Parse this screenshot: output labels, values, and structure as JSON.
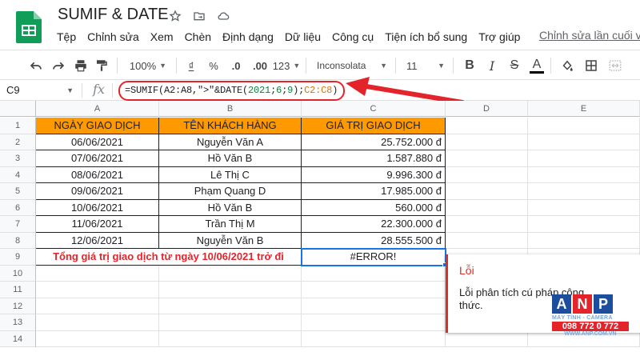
{
  "doc": {
    "title": "SUMIF & DATE"
  },
  "menu": [
    "Tệp",
    "Chỉnh sửa",
    "Xem",
    "Chèn",
    "Định dạng",
    "Dữ liệu",
    "Công cụ",
    "Tiện ích bổ sung",
    "Trợ giúp"
  ],
  "last_edit": "Chỉnh sửa lần cuối vài",
  "toolbar": {
    "zoom": "100%",
    "currency": "₫",
    "percent": "%",
    "dec_less": ".0",
    "dec_more": ".00",
    "format_more": "123",
    "font": "Inconsolata",
    "font_size": "11",
    "bold": "B",
    "italic": "I",
    "strike": "S",
    "text_color": "A"
  },
  "formula_bar": {
    "cell_ref": "C9",
    "fx": "fx",
    "formula_parts": {
      "p1": "=SUMIF(",
      "p2": "A2:A8",
      "p3": ",\">\"&DATE(",
      "p4": "2021",
      "p5": ";",
      "p6": "6",
      "p7": ";",
      "p8": "9",
      "p9": ");",
      "p10": "C2:C8",
      "p11": ")"
    }
  },
  "columns": [
    "A",
    "B",
    "C",
    "D",
    "E"
  ],
  "rows": [
    "1",
    "2",
    "3",
    "4",
    "5",
    "6",
    "7",
    "8",
    "9",
    "10",
    "11",
    "12",
    "13",
    "14"
  ],
  "table": {
    "headers": [
      "NGÀY GIAO DỊCH",
      "TÊN KHÁCH HÀNG",
      "GIÁ TRỊ GIAO DỊCH"
    ],
    "rows": [
      [
        "06/06/2021",
        "Nguyễn Văn A",
        "25.752.000 đ"
      ],
      [
        "07/06/2021",
        "Hồ Văn B",
        "1.587.880 đ"
      ],
      [
        "08/06/2021",
        "Lê Thị C",
        "9.996.300 đ"
      ],
      [
        "09/06/2021",
        "Phạm Quang D",
        "17.985.000 đ"
      ],
      [
        "10/06/2021",
        "Hồ Văn B",
        "560.000 đ"
      ],
      [
        "11/06/2021",
        "Trần Thị M",
        "22.300.000 đ"
      ],
      [
        "12/06/2021",
        "Nguyễn Văn B",
        "28.555.500 đ"
      ]
    ],
    "total_label": "Tổng giá trị giao dịch từ ngày 10/06/2021 trở đi",
    "total_value": "#ERROR!"
  },
  "error_popup": {
    "title": "Lỗi",
    "message": "Lỗi phân tích cú pháp công thức."
  },
  "watermark": {
    "letters": [
      "A",
      "N",
      "P"
    ],
    "tagline": "MÁY TÍNH - CAMERA",
    "phone": "098 772 0 772",
    "url": "WWW.ANP.COM.VN"
  },
  "colors": {
    "header_fill": "#ff9900",
    "annotation_red": "#e3242b",
    "selection_blue": "#1a73e8",
    "sheets_green": "#0f9d58"
  }
}
